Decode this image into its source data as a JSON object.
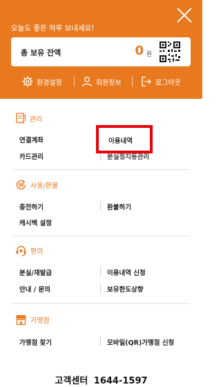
{
  "header": {
    "greeting": "오늘도 좋은 하루 보내세요!",
    "balance_label": "총 보유 잔액",
    "balance_value": "0",
    "balance_unit": "원",
    "menu": [
      {
        "label": "환경설정",
        "icon": "gear-icon"
      },
      {
        "label": "회원정보",
        "icon": "user-icon"
      },
      {
        "label": "로그아웃",
        "icon": "logout-icon"
      }
    ]
  },
  "sections": [
    {
      "title": "관리",
      "icon": "receipt-icon",
      "items": [
        "연결계좌",
        "이용내역",
        "카드관리",
        "분실정지등관리"
      ]
    },
    {
      "title": "사용/환불",
      "icon": "won-refresh-icon",
      "items": [
        "충전하기",
        "환불하기",
        "캐시백 설정"
      ]
    },
    {
      "title": "편의",
      "icon": "headset-icon",
      "items": [
        "분실/재발급",
        "이용내역 신청",
        "안내 / 문의",
        "보유한도상향"
      ]
    },
    {
      "title": "가맹점",
      "icon": "store-icon",
      "items": [
        "가맹점 찾기",
        "모바일(QR)가맹점 신청"
      ]
    }
  ],
  "customer_center": {
    "label": "고객센터",
    "phone": "1644-1597"
  },
  "colors": {
    "accent": "#e8791f",
    "highlight": "#e8000b"
  }
}
